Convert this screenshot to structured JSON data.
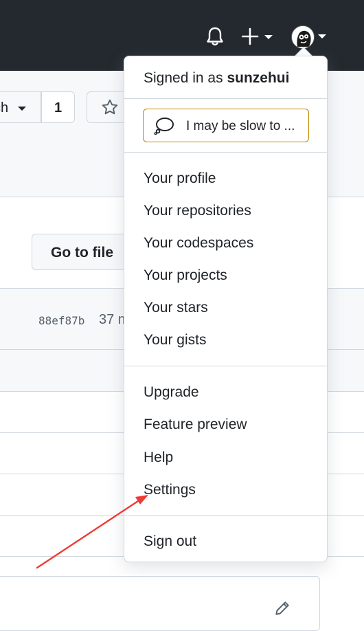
{
  "header": {
    "bell_icon": "bell-icon",
    "plus_icon": "plus-icon",
    "avatar_icon": "avatar"
  },
  "repo": {
    "branch_label": "ch",
    "count": "1",
    "go_to_file": "Go to file",
    "commit_hash": "88ef87b",
    "commit_age": "37 m"
  },
  "menu": {
    "signed_in_prefix": "Signed in as",
    "username": "sunzehui",
    "status_text": "I may be slow to ...",
    "section1": [
      "Your profile",
      "Your repositories",
      "Your codespaces",
      "Your projects",
      "Your stars",
      "Your gists"
    ],
    "section2": [
      "Upgrade",
      "Feature preview",
      "Help",
      "Settings"
    ],
    "sign_out": "Sign out"
  },
  "colors": {
    "header_bg": "#24292f",
    "status_border": "#bf8700",
    "annotation_arrow": "#ef3b35"
  }
}
